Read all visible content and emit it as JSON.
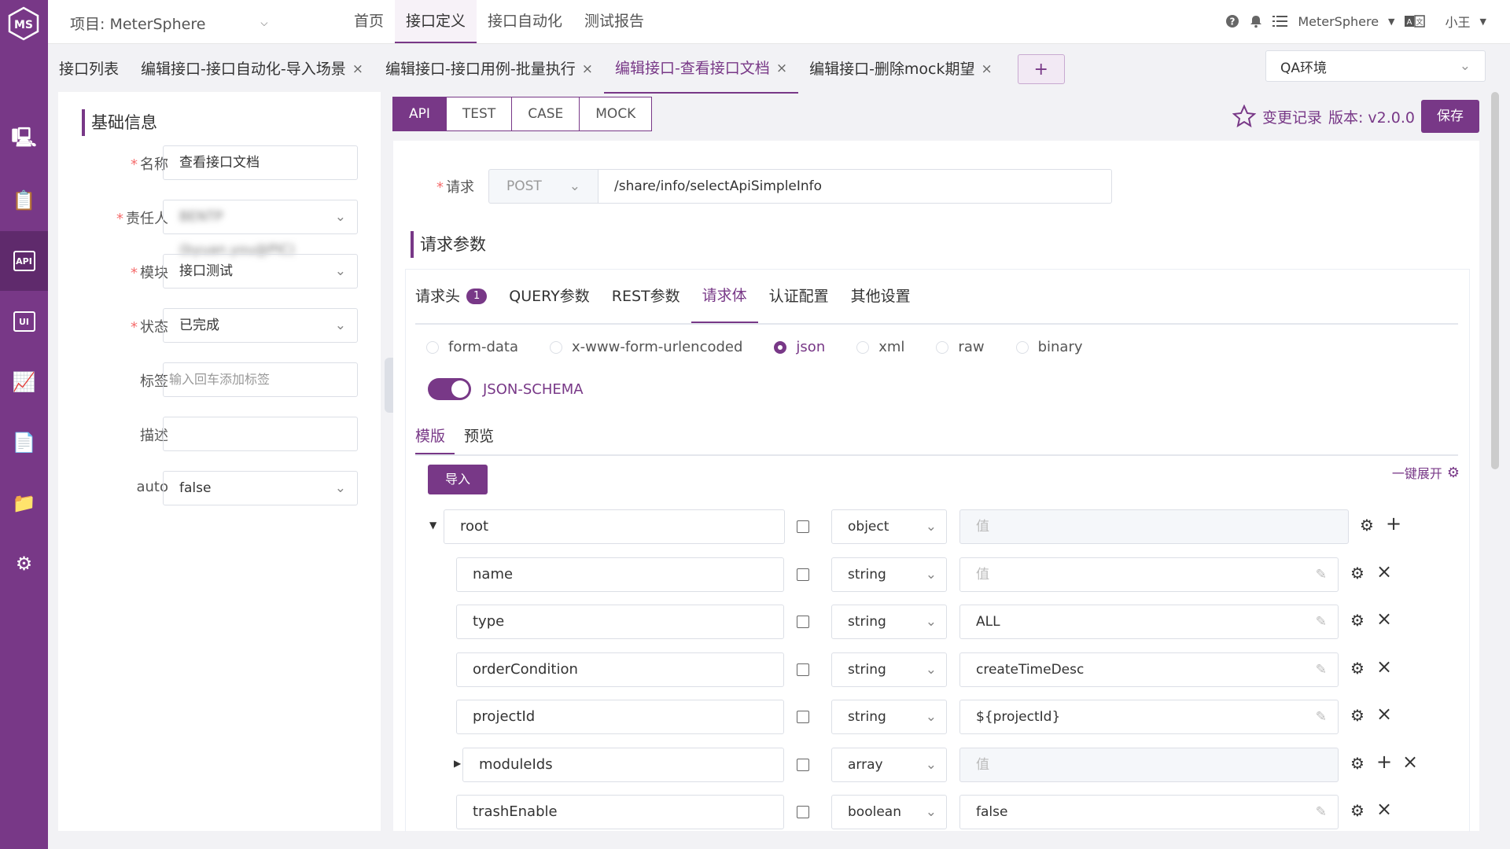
{
  "app": {
    "logo_text": "MS"
  },
  "sidebar": {
    "items": [
      {
        "icon": "monitor-icon",
        "label": "",
        "active": false
      },
      {
        "icon": "clipboard-icon",
        "label": "",
        "active": false
      },
      {
        "icon": "api-icon",
        "label": "API",
        "active": true
      },
      {
        "icon": "ui-icon",
        "label": "UI",
        "active": false
      },
      {
        "icon": "performance-icon",
        "label": "",
        "active": false
      },
      {
        "icon": "report-icon",
        "label": "",
        "active": false
      },
      {
        "icon": "folder-icon",
        "label": "",
        "active": false
      },
      {
        "icon": "settings-icon",
        "label": "",
        "active": false
      }
    ]
  },
  "topbar": {
    "project": "项目: MeterSphere",
    "nav": [
      "首页",
      "接口定义",
      "接口自动化",
      "测试报告"
    ],
    "nav_active": 1,
    "workspace": "MeterSphere",
    "user": "小王"
  },
  "tabs": {
    "items": [
      {
        "label": "接口列表",
        "closable": false,
        "active": false
      },
      {
        "label": "编辑接口-接口自动化-导入场景",
        "closable": true,
        "active": false
      },
      {
        "label": "编辑接口-接口用例-批量执行",
        "closable": true,
        "active": false
      },
      {
        "label": "编辑接口-查看接口文档",
        "closable": true,
        "active": true
      },
      {
        "label": "编辑接口-删除mock期望",
        "closable": true,
        "active": false
      }
    ],
    "add_label": "+",
    "close_glyph": "×"
  },
  "environment": {
    "value": "QA环境"
  },
  "basic": {
    "title": "基础信息",
    "fields": {
      "name": {
        "label": "名称",
        "value": "查看接口文档",
        "required": true
      },
      "owner": {
        "label": "责任人",
        "value": "BENTP (byuan.you@PIC)",
        "required": true
      },
      "module": {
        "label": "模块",
        "value": "接口测试",
        "required": true
      },
      "status": {
        "label": "状态",
        "value": "已完成",
        "required": true
      },
      "tags": {
        "label": "标签",
        "placeholder": "输入回车添加标签",
        "required": false
      },
      "desc": {
        "label": "描述",
        "value": "",
        "required": false
      },
      "auto": {
        "label": "auto",
        "value": "false",
        "required": false
      }
    }
  },
  "protocol_tabs": [
    "API",
    "TEST",
    "CASE",
    "MOCK"
  ],
  "header_actions": {
    "changelog": "变更记录",
    "version": "版本: v2.0.0",
    "save": "保存"
  },
  "request": {
    "label": "请求",
    "method": "POST",
    "url": "/share/info/selectApiSimpleInfo"
  },
  "params": {
    "title": "请求参数",
    "tabs": [
      {
        "label": "请求头",
        "badge": "1"
      },
      {
        "label": "QUERY参数"
      },
      {
        "label": "REST参数"
      },
      {
        "label": "请求体"
      },
      {
        "label": "认证配置"
      },
      {
        "label": "其他设置"
      }
    ],
    "active_tab": 3,
    "body_types": [
      "form-data",
      "x-www-form-urlencoded",
      "json",
      "xml",
      "raw",
      "binary"
    ],
    "body_type_selected": "json",
    "json_schema_toggle": {
      "label": "JSON-SCHEMA",
      "on": true
    },
    "sub_tabs": [
      "模版",
      "预览"
    ],
    "import": "导入",
    "expand_all": "一键展开"
  },
  "schema": {
    "value_placeholder": "值",
    "rows": [
      {
        "name": "root",
        "type": "object",
        "value": "",
        "indent": 0,
        "expanded": true,
        "can_add": true,
        "can_delete": false,
        "editable": false
      },
      {
        "name": "name",
        "type": "string",
        "value": "",
        "indent": 1,
        "can_add": false,
        "can_delete": true,
        "editable": true
      },
      {
        "name": "type",
        "type": "string",
        "value": "ALL",
        "indent": 1,
        "can_add": false,
        "can_delete": true,
        "editable": true
      },
      {
        "name": "orderCondition",
        "type": "string",
        "value": "createTimeDesc",
        "indent": 1,
        "can_add": false,
        "can_delete": true,
        "editable": true
      },
      {
        "name": "projectId",
        "type": "string",
        "value": "${projectId}",
        "indent": 1,
        "can_add": false,
        "can_delete": true,
        "editable": true
      },
      {
        "name": "moduleIds",
        "type": "array",
        "value": "",
        "indent": 1,
        "collapsed": true,
        "can_add": true,
        "can_delete": true,
        "editable": false
      },
      {
        "name": "trashEnable",
        "type": "boolean",
        "value": "false",
        "indent": 1,
        "can_add": false,
        "can_delete": true,
        "editable": true
      }
    ]
  },
  "colors": {
    "brand": "#783887",
    "sidebar_active": "#5f2a6c",
    "required": "#f56c6c"
  }
}
